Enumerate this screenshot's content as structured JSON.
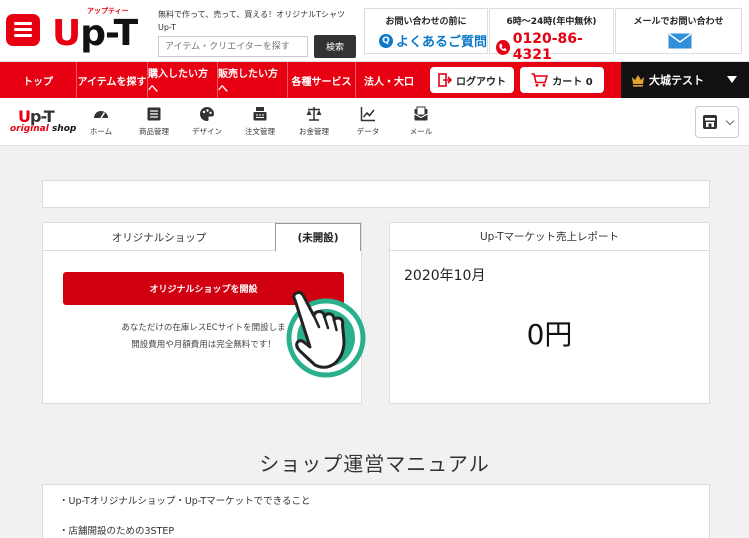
{
  "header": {
    "logo_ruby": "アップティー",
    "logo_text": "p-T",
    "logo_u": "U",
    "tagline": "無料で作って、売って、買える！オリジナルTシャツUp-T",
    "search_placeholder": "アイテム・クリエイターを探す",
    "search_button": "検索",
    "faq": {
      "title": "お問い合わせの前に",
      "link": "よくあるご質問",
      "icon": "Q"
    },
    "tel": {
      "title": "6時～24時(年中無休)",
      "number": "0120-86-4321"
    },
    "mail": {
      "title": "メールでお問い合わせ"
    }
  },
  "nav": {
    "items": [
      "トップ",
      "アイテムを探す",
      "購入したい方へ",
      "販売したい方へ",
      "各種サービス",
      "法人・大口"
    ],
    "logout": "ログアウト",
    "cart": "カート 0",
    "user": "大城テスト"
  },
  "subnav": {
    "logo_up": "p-T",
    "logo_u": "U",
    "logo_original": "original",
    "logo_shop": "shop",
    "items": [
      "ホーム",
      "商品管理",
      "デザイン",
      "注文管理",
      "お金管理",
      "データ",
      "メール"
    ]
  },
  "shop": {
    "tab_label": "オリジナルショップ",
    "status": "(未開設)",
    "open_button": "オリジナルショップを開設",
    "desc_line1": "あなただけの在庫レスECサイトを開設しま",
    "desc_line2": "開設費用や月額費用は完全無料です！"
  },
  "report": {
    "title": "Up-Tマーケット売上レポート",
    "month": "2020年10月",
    "amount": "0円"
  },
  "manual": {
    "title": "ショップ運営マニュアル",
    "items": [
      "・Up-Tオリジナルショップ・Up-Tマーケットでできること",
      "・店舗開設のための3STEP"
    ]
  },
  "colors": {
    "brand_red": "#e60012",
    "link_blue": "#0a78c8",
    "hand_teal": "#2bb08e"
  }
}
